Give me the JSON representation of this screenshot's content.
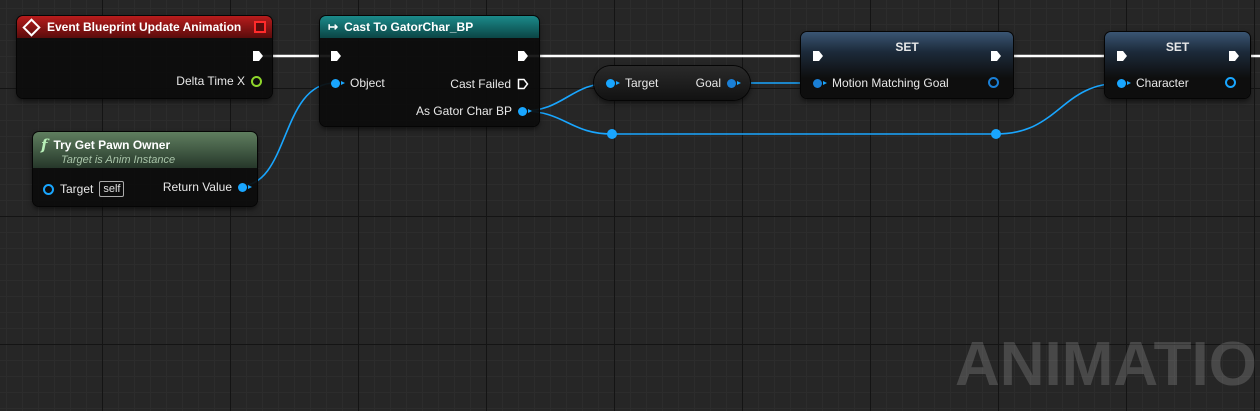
{
  "nodes": {
    "event": {
      "title": "Event Blueprint Update Animation",
      "delta_label": "Delta Time X"
    },
    "try_get": {
      "title": "Try Get Pawn Owner",
      "subtitle": "Target is Anim Instance",
      "target_label": "Target",
      "self_label": "self",
      "return_label": "Return Value"
    },
    "cast": {
      "title": "Cast To GatorChar_BP",
      "object_label": "Object",
      "failed_label": "Cast Failed",
      "as_label": "As Gator Char BP"
    },
    "getter": {
      "target_label": "Target",
      "goal_label": "Goal"
    },
    "set1": {
      "title": "SET",
      "pin_label": "Motion Matching Goal"
    },
    "set2": {
      "title": "SET",
      "pin_label": "Character"
    }
  },
  "watermark": "ANIMATION",
  "colors": {
    "event_header": "#a31414",
    "func_header": "#4e6b4e",
    "cast_header": "#0f6f6f",
    "set_header": "#2d4d73",
    "object_pin": "#19a6ff",
    "float_pin": "#8ed62b",
    "exec_wire": "#ffffff"
  }
}
